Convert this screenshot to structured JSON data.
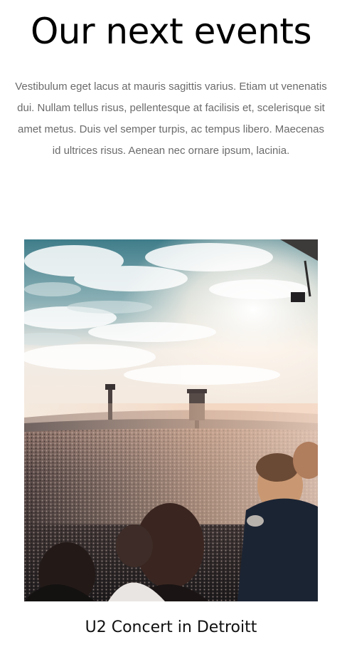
{
  "section": {
    "heading": "Our next events",
    "intro": "Vestibulum eget lacus at mauris sagittis varius. Etiam ut venenatis dui. Nullam tellus risus, pellentesque at facilisis et, scelerisque sit amet metus. Duis vel semper turpis, ac tempus libero. Maecenas id ultrices risus. Aenean nec ornare ipsum, lacinia."
  },
  "events": [
    {
      "title": "U2 Concert in Detroitt"
    }
  ]
}
